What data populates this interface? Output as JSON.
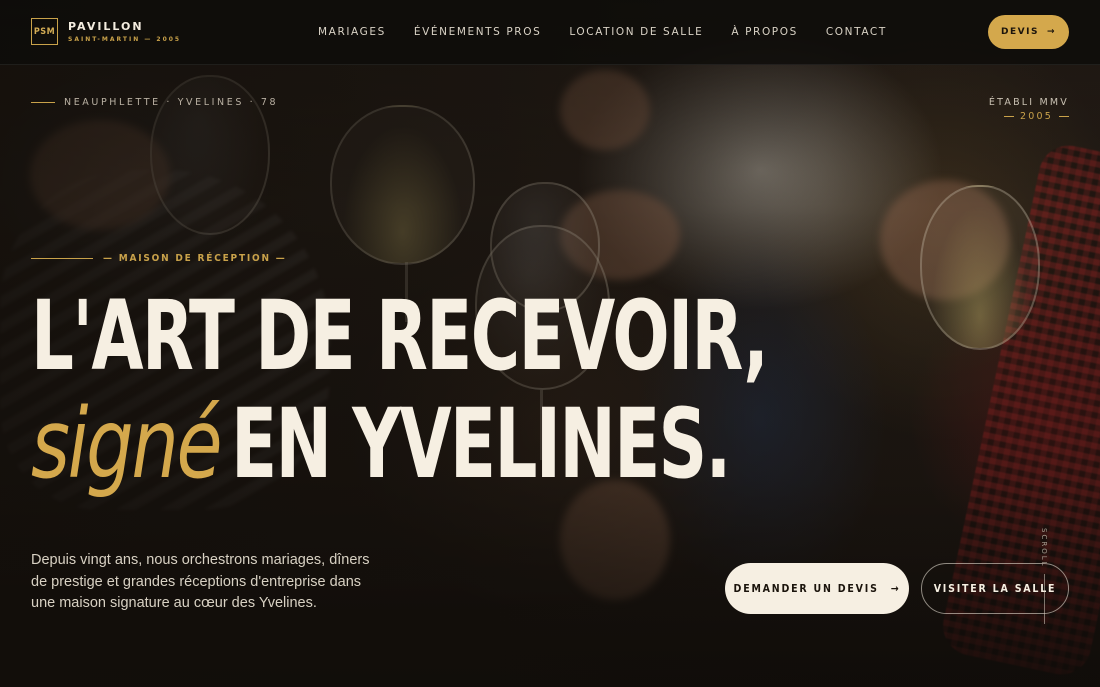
{
  "brand": {
    "monogram": "PSM",
    "name": "PAVILLON",
    "subtitle": "SAINT-MARTIN — 2005"
  },
  "nav": {
    "items": [
      {
        "label": "MARIAGES"
      },
      {
        "label": "ÉVÉNEMENTS PROS"
      },
      {
        "label": "LOCATION DE SALLE"
      },
      {
        "label": "À PROPOS"
      },
      {
        "label": "CONTACT"
      }
    ],
    "cta_label": "DEVIS",
    "cta_icon": "arrow-right-icon"
  },
  "hero": {
    "location": "NEAUPHLETTE · YVELINES · 78",
    "established_label": "ÉTABLI MMV",
    "established_year": "2005",
    "eyebrow": "— MAISON DE RÉCEPTION —",
    "headline_line1": "L'ART DE RECEVOIR,",
    "headline_italic": "signé",
    "headline_line2": "EN YVELINES.",
    "intro": "Depuis vingt ans, nous orchestrons mariages, dîners de prestige et grandes réceptions d'entreprise dans une maison signature au cœur des Yvelines.",
    "primary_cta": "DEMANDER UN DEVIS",
    "secondary_cta": "VISITER LA SALLE",
    "scroll_label": "SCROLL"
  },
  "colors": {
    "accent": "#d4a84c",
    "cream": "#f6efe2",
    "dark": "#14100c"
  }
}
